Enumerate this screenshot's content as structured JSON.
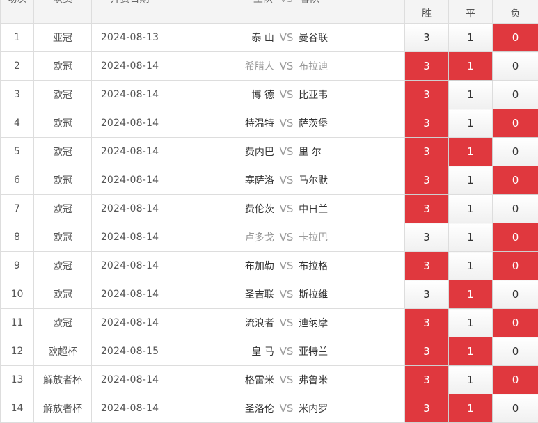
{
  "header": {
    "no": "场次",
    "league": "联赛",
    "date": "开赛日期",
    "home": "主队",
    "vs": "VS",
    "away": "客队",
    "win": "胜",
    "draw": "平",
    "lose": "负"
  },
  "colors": {
    "selected": "#e0383e",
    "vs": "#999999"
  },
  "rows": [
    {
      "no": "1",
      "league": "亚冠",
      "date": "2024-08-13",
      "home": "泰 山",
      "away": "曼谷联",
      "win": "3",
      "draw": "1",
      "lose": "0",
      "win_sel": false,
      "draw_sel": false,
      "lose_sel": true,
      "dim": false
    },
    {
      "no": "2",
      "league": "欧冠",
      "date": "2024-08-14",
      "home": "希腊人",
      "away": "布拉迪",
      "win": "3",
      "draw": "1",
      "lose": "0",
      "win_sel": true,
      "draw_sel": true,
      "lose_sel": false,
      "dim": true
    },
    {
      "no": "3",
      "league": "欧冠",
      "date": "2024-08-14",
      "home": "博 德",
      "away": "比亚韦",
      "win": "3",
      "draw": "1",
      "lose": "0",
      "win_sel": true,
      "draw_sel": false,
      "lose_sel": false,
      "dim": false
    },
    {
      "no": "4",
      "league": "欧冠",
      "date": "2024-08-14",
      "home": "特温特",
      "away": "萨茨堡",
      "win": "3",
      "draw": "1",
      "lose": "0",
      "win_sel": true,
      "draw_sel": false,
      "lose_sel": true,
      "dim": false
    },
    {
      "no": "5",
      "league": "欧冠",
      "date": "2024-08-14",
      "home": "费内巴",
      "away": "里 尔",
      "win": "3",
      "draw": "1",
      "lose": "0",
      "win_sel": true,
      "draw_sel": true,
      "lose_sel": false,
      "dim": false
    },
    {
      "no": "6",
      "league": "欧冠",
      "date": "2024-08-14",
      "home": "塞萨洛",
      "away": "马尔默",
      "win": "3",
      "draw": "1",
      "lose": "0",
      "win_sel": true,
      "draw_sel": false,
      "lose_sel": true,
      "dim": false
    },
    {
      "no": "7",
      "league": "欧冠",
      "date": "2024-08-14",
      "home": "费伦茨",
      "away": "中日兰",
      "win": "3",
      "draw": "1",
      "lose": "0",
      "win_sel": true,
      "draw_sel": false,
      "lose_sel": false,
      "dim": false
    },
    {
      "no": "8",
      "league": "欧冠",
      "date": "2024-08-14",
      "home": "卢多戈",
      "away": "卡拉巴",
      "win": "3",
      "draw": "1",
      "lose": "0",
      "win_sel": false,
      "draw_sel": false,
      "lose_sel": true,
      "dim": true
    },
    {
      "no": "9",
      "league": "欧冠",
      "date": "2024-08-14",
      "home": "布加勒",
      "away": "布拉格",
      "win": "3",
      "draw": "1",
      "lose": "0",
      "win_sel": true,
      "draw_sel": false,
      "lose_sel": true,
      "dim": false
    },
    {
      "no": "10",
      "league": "欧冠",
      "date": "2024-08-14",
      "home": "圣吉联",
      "away": "斯拉维",
      "win": "3",
      "draw": "1",
      "lose": "0",
      "win_sel": false,
      "draw_sel": true,
      "lose_sel": false,
      "dim": false
    },
    {
      "no": "11",
      "league": "欧冠",
      "date": "2024-08-14",
      "home": "流浪者",
      "away": "迪纳摩",
      "win": "3",
      "draw": "1",
      "lose": "0",
      "win_sel": true,
      "draw_sel": false,
      "lose_sel": true,
      "dim": false
    },
    {
      "no": "12",
      "league": "欧超杯",
      "date": "2024-08-15",
      "home": "皇 马",
      "away": "亚特兰",
      "win": "3",
      "draw": "1",
      "lose": "0",
      "win_sel": true,
      "draw_sel": true,
      "lose_sel": false,
      "dim": false
    },
    {
      "no": "13",
      "league": "解放者杯",
      "date": "2024-08-14",
      "home": "格雷米",
      "away": "弗鲁米",
      "win": "3",
      "draw": "1",
      "lose": "0",
      "win_sel": true,
      "draw_sel": false,
      "lose_sel": true,
      "dim": false
    },
    {
      "no": "14",
      "league": "解放者杯",
      "date": "2024-08-14",
      "home": "圣洛伦",
      "away": "米内罗",
      "win": "3",
      "draw": "1",
      "lose": "0",
      "win_sel": true,
      "draw_sel": true,
      "lose_sel": false,
      "dim": false
    }
  ]
}
